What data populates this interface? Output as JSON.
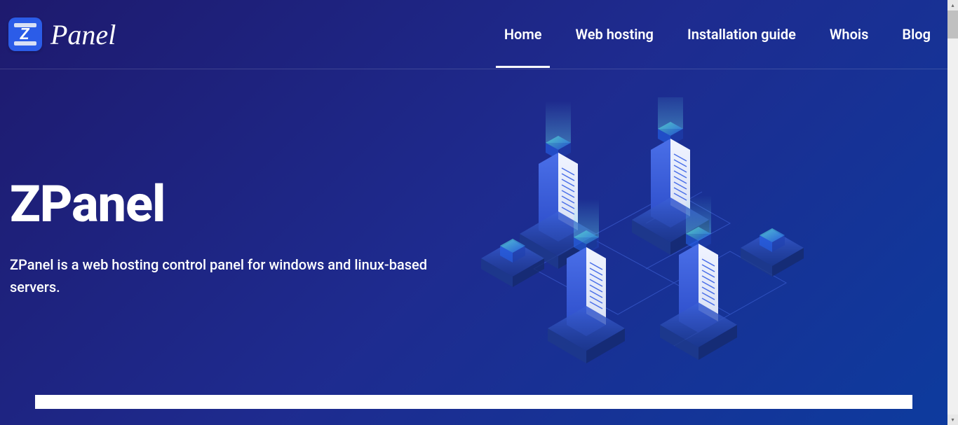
{
  "brand": {
    "name": "Panel",
    "logo_letter": "Z"
  },
  "nav": {
    "items": [
      {
        "label": "Home",
        "active": true
      },
      {
        "label": "Web hosting",
        "active": false
      },
      {
        "label": "Installation guide",
        "active": false
      },
      {
        "label": "Whois",
        "active": false
      },
      {
        "label": "Blog",
        "active": false
      }
    ]
  },
  "hero": {
    "title": "ZPanel",
    "subtitle": "ZPanel is a web hosting control panel for windows and linux-based servers."
  }
}
